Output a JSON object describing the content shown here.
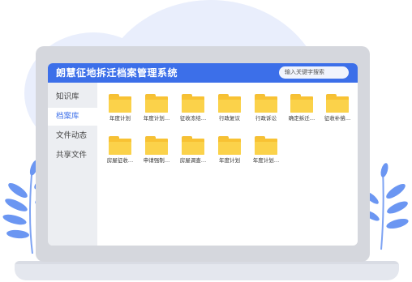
{
  "app": {
    "title": "朗慧征地拆迁档案管理系统",
    "search_placeholder": "输入关键字搜索"
  },
  "sidebar": {
    "items": [
      {
        "label": "知识库",
        "active": false
      },
      {
        "label": "档案库",
        "active": true
      },
      {
        "label": "文件动态",
        "active": false
      },
      {
        "label": "共享文件",
        "active": false
      }
    ]
  },
  "folders": [
    {
      "label": "年度计划"
    },
    {
      "label": "年度计划…"
    },
    {
      "label": "征收冻结…"
    },
    {
      "label": "行政复议"
    },
    {
      "label": "行政诉讼"
    },
    {
      "label": "确定拆迁…"
    },
    {
      "label": "征收补偿…"
    },
    {
      "label": "房屋征收…"
    },
    {
      "label": "申请强制…"
    },
    {
      "label": "房屋调查…"
    },
    {
      "label": "年度计划"
    },
    {
      "label": "年度计划…"
    }
  ],
  "colors": {
    "accent": "#3c6fe9",
    "folder": "#f8c233",
    "leaf": "#6b96f2",
    "background_blob": "#e9eefc"
  }
}
